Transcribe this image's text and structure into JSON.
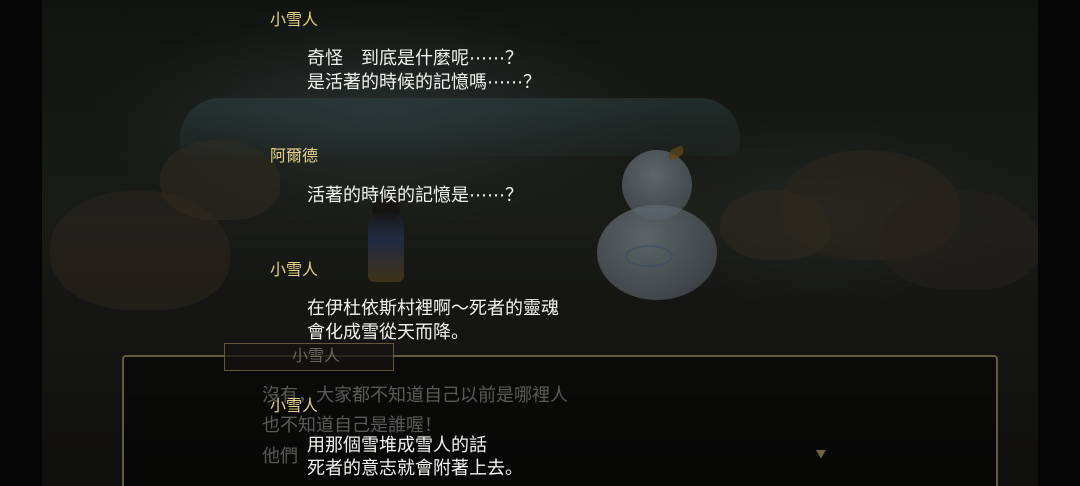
{
  "scene": {
    "snowman_icon": "snowman-icon",
    "hero_icon": "hero-sprite-icon"
  },
  "message_window": {
    "speaker": "小雪人",
    "lines": [
      "沒有，大家都不知道自己以前是哪裡人",
      "也不知道自己是誰喔！",
      "他們"
    ],
    "next_icon": "next-arrow-icon",
    "next_glyph": "⯆"
  },
  "log": {
    "entries": [
      {
        "speaker": "小雪人",
        "lines": [
          "奇怪　到底是什麼呢⋯⋯？",
          "是活著的時候的記憶嗎⋯⋯？"
        ]
      },
      {
        "speaker": "阿爾德",
        "lines": [
          "活著的時候的記憶是⋯⋯？"
        ]
      },
      {
        "speaker": "小雪人",
        "lines": [
          "在伊杜依斯村裡啊～死者的靈魂",
          "會化成雪從天而降。"
        ]
      },
      {
        "speaker": "小雪人",
        "lines": [
          "用那個雪堆成雪人的話",
          "死者的意志就會附著上去。"
        ]
      }
    ]
  }
}
